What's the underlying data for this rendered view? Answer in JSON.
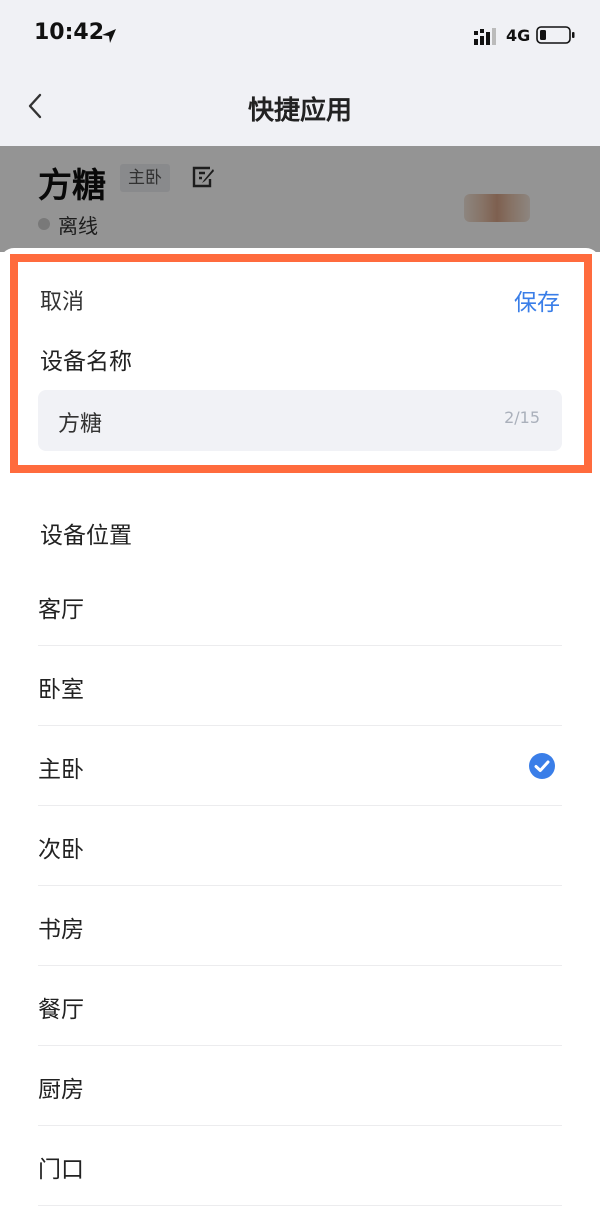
{
  "status_bar": {
    "time": "10:42",
    "network": "4G"
  },
  "nav": {
    "title": "快捷应用"
  },
  "device": {
    "name": "方糖",
    "room_badge": "主卧",
    "status_text": "离线"
  },
  "sheet": {
    "cancel_label": "取消",
    "save_label": "保存",
    "name_label": "设备名称",
    "name_value": "方糖",
    "name_counter": "2/15",
    "location_label": "设备位置",
    "locations": [
      {
        "label": "客厅",
        "selected": false
      },
      {
        "label": "卧室",
        "selected": false
      },
      {
        "label": "主卧",
        "selected": true
      },
      {
        "label": "次卧",
        "selected": false
      },
      {
        "label": "书房",
        "selected": false
      },
      {
        "label": "餐厅",
        "selected": false
      },
      {
        "label": "厨房",
        "selected": false
      },
      {
        "label": "门口",
        "selected": false
      }
    ]
  },
  "colors": {
    "accent": "#3a7ee8",
    "highlight": "#ff6b3d"
  }
}
